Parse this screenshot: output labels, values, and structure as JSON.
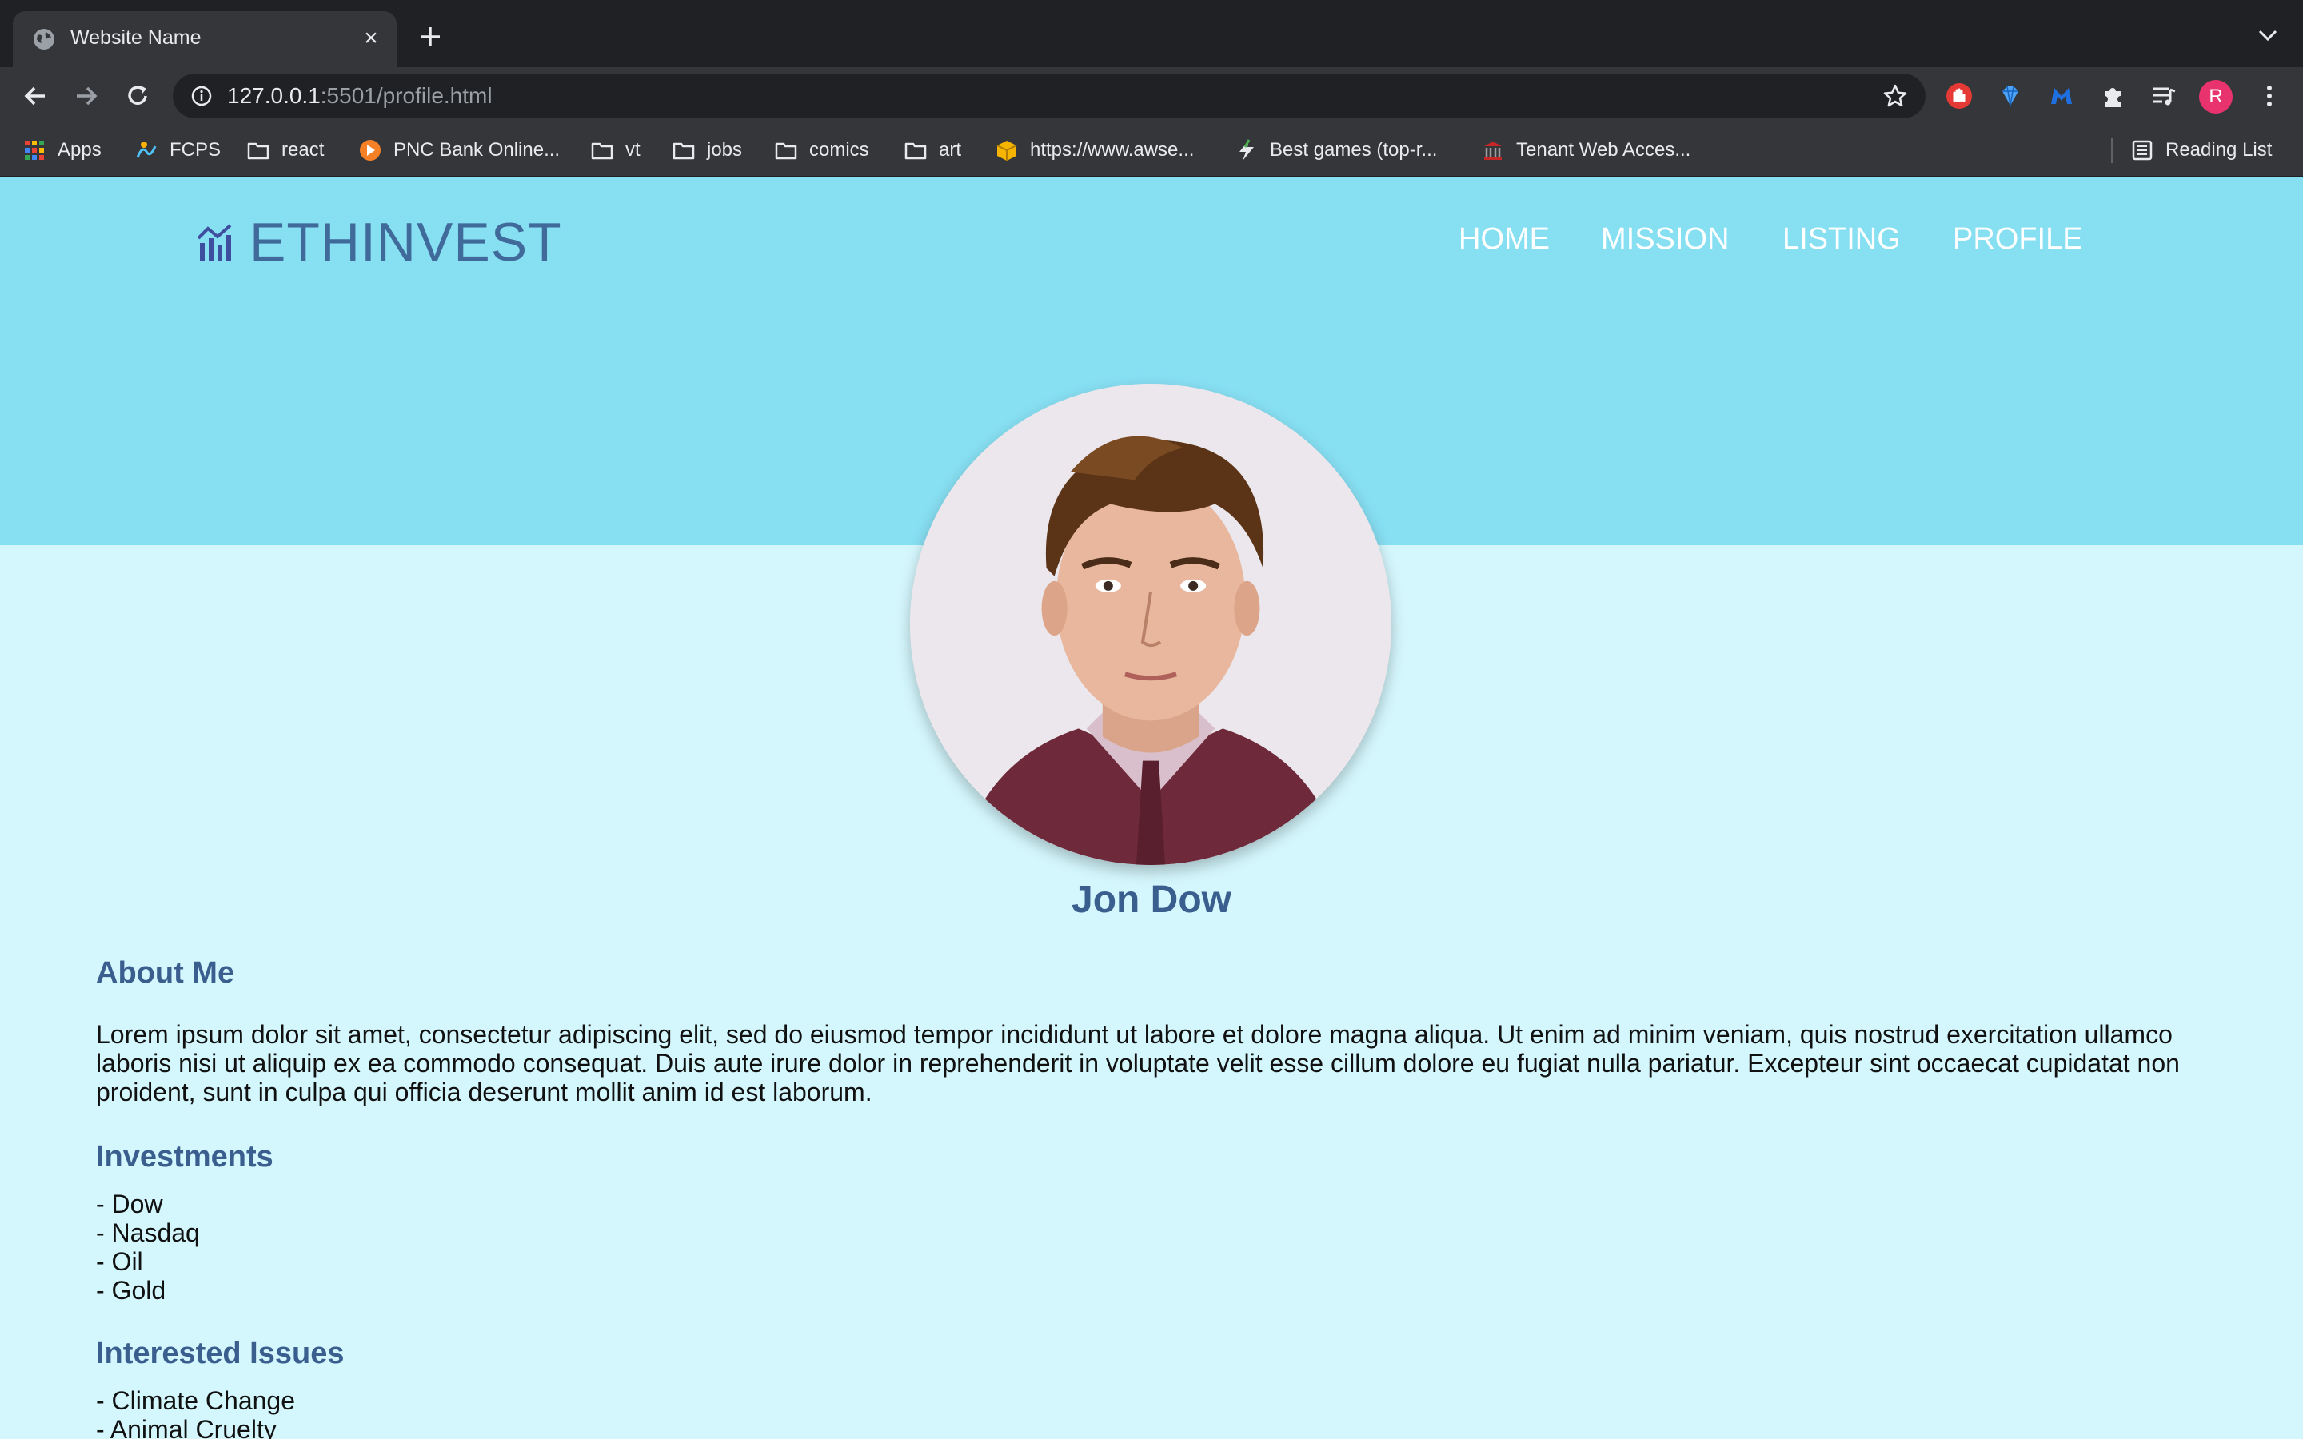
{
  "browser": {
    "tab_title": "Website Name",
    "url_host": "127.0.0.1",
    "url_rest": ":5501/profile.html",
    "profile_initial": "R",
    "bookmarks": [
      {
        "label": "Apps",
        "icon": "apps-grid-icon"
      },
      {
        "label": "FCPS",
        "icon": "fcps-icon"
      },
      {
        "label": "react",
        "icon": "folder-icon"
      },
      {
        "label": "PNC Bank Online...",
        "icon": "pnc-icon"
      },
      {
        "label": "vt",
        "icon": "folder-icon"
      },
      {
        "label": "jobs",
        "icon": "folder-icon"
      },
      {
        "label": "comics",
        "icon": "folder-icon"
      },
      {
        "label": "art",
        "icon": "folder-icon"
      },
      {
        "label": "https://www.awse...",
        "icon": "package-icon"
      },
      {
        "label": "Best games (top-r...",
        "icon": "lightning-icon"
      },
      {
        "label": "Tenant Web Acces...",
        "icon": "bank-icon"
      }
    ],
    "reading_list": "Reading List"
  },
  "site": {
    "logo": "ETHINVEST",
    "nav": [
      "HOME",
      "MISSION",
      "LISTING",
      "PROFILE"
    ]
  },
  "profile": {
    "name": "Jon Dow",
    "about_title": "About Me",
    "about_text": "Lorem ipsum dolor sit amet, consectetur adipiscing elit, sed do eiusmod tempor incididunt ut labore et dolore magna aliqua. Ut enim ad minim veniam, quis nostrud exercitation ullamco laboris nisi ut aliquip ex ea commodo consequat. Duis aute irure dolor in reprehenderit in voluptate velit esse cillum dolore eu fugiat nulla pariatur. Excepteur sint occaecat cupidatat non proident, sunt in culpa qui officia deserunt mollit anim id est laborum.",
    "investments_title": "Investments",
    "investments": [
      "- Dow",
      "- Nasdaq",
      "- Oil",
      "- Gold"
    ],
    "issues_title": "Interested Issues",
    "issues": [
      "- Climate Change",
      "- Animal Cruelty"
    ]
  },
  "colors": {
    "hero": "#87dff2",
    "page": "#d4f7fd",
    "heading": "#3a5f8f"
  }
}
